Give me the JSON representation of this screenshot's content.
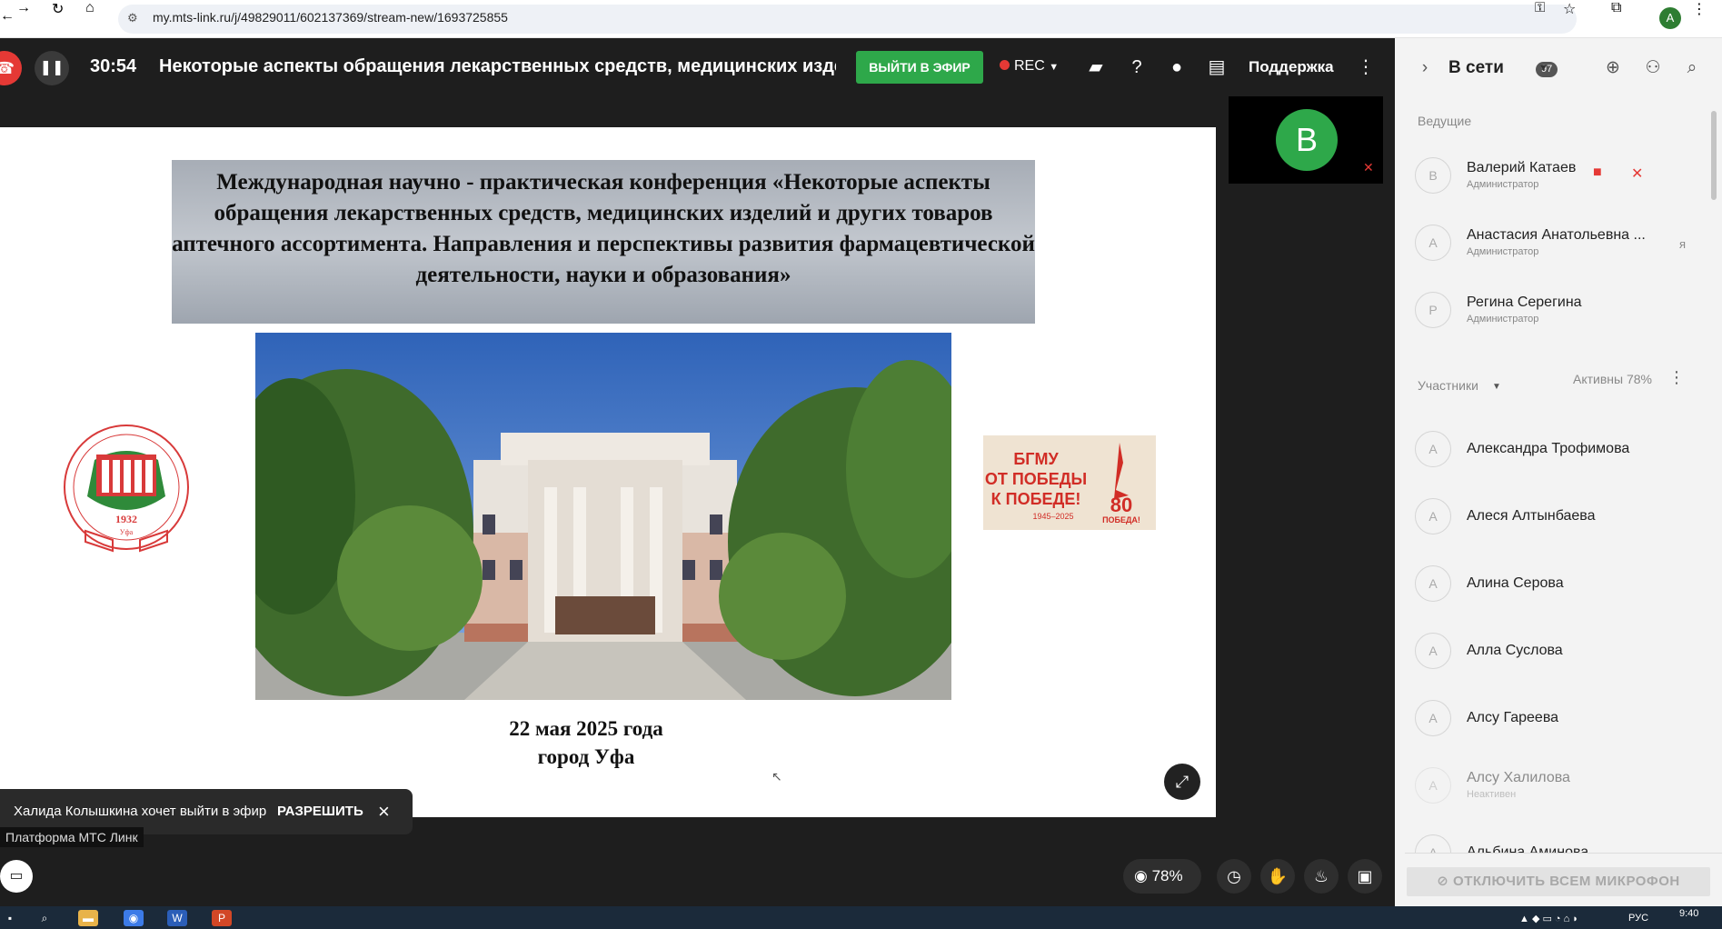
{
  "browser": {
    "url": "my.mts-link.ru/j/49829011/602137369/stream-new/1693725855",
    "profile_initial": "A"
  },
  "header": {
    "timer": "30:54",
    "title": "Некоторые аспекты обращения лекарственных средств, медицинских издел",
    "go_live_label": "ВЫЙТИ В ЭФИР",
    "rec_label": "REC",
    "support_label": "Поддержка"
  },
  "slide": {
    "title": "Международная научно - практическая конференция «Некоторые аспекты  обращения лекарственных средств, медицинских изделий и других товаров аптечного ассортимента. Направления и перспективы развития фармацевтической деятельности, науки и образования»",
    "date_line": "22 мая 2025 года",
    "city_line": "город Уфа",
    "logo_year": "1932",
    "logo_city": "Уфа",
    "banner_line1": "БГМУ",
    "banner_line2": "ОТ ПОБЕДЫ",
    "banner_line3": "К ПОБЕДЕ!",
    "banner_years": "1945–2025",
    "banner_badge": "80",
    "banner_badge_sub": "ПОБЕДА!"
  },
  "self_tile": {
    "initial": "B"
  },
  "request": {
    "text": "Халида Колышкина хочет выйти в эфир",
    "allow_label": "РАЗРЕШИТЬ"
  },
  "platform_label": "Платформа МТС Линк",
  "toolbar": {
    "viewers_percent": "78%"
  },
  "sidebar": {
    "title": "В сети",
    "count": "97",
    "hosts_label": "Ведущие",
    "participants_label": "Участники",
    "active_label": "Активны 78%",
    "mute_all_label": "ОТКЛЮЧИТЬ ВСЕМ МИКРОФОН",
    "hosts": [
      {
        "initial": "В",
        "name": "Валерий Катаев",
        "role": "Администратор"
      },
      {
        "initial": "А",
        "name": "Анастасия Анатольевна ...",
        "role": "Администратор",
        "me": "я"
      },
      {
        "initial": "Р",
        "name": "Регина Серегина",
        "role": "Администратор"
      }
    ],
    "participants": [
      {
        "initial": "А",
        "name": "Александра Трофимова"
      },
      {
        "initial": "А",
        "name": "Алеся Алтынбаева"
      },
      {
        "initial": "А",
        "name": "Алина Серова"
      },
      {
        "initial": "А",
        "name": "Алла Суслова"
      },
      {
        "initial": "А",
        "name": "Алсу Гареева"
      },
      {
        "initial": "А",
        "name": "Алсу Халилова",
        "role": "Неактивен"
      },
      {
        "initial": "А",
        "name": "Альбина Аминова"
      }
    ]
  },
  "taskbar": {
    "lang": "РУС",
    "time": "9:40"
  }
}
